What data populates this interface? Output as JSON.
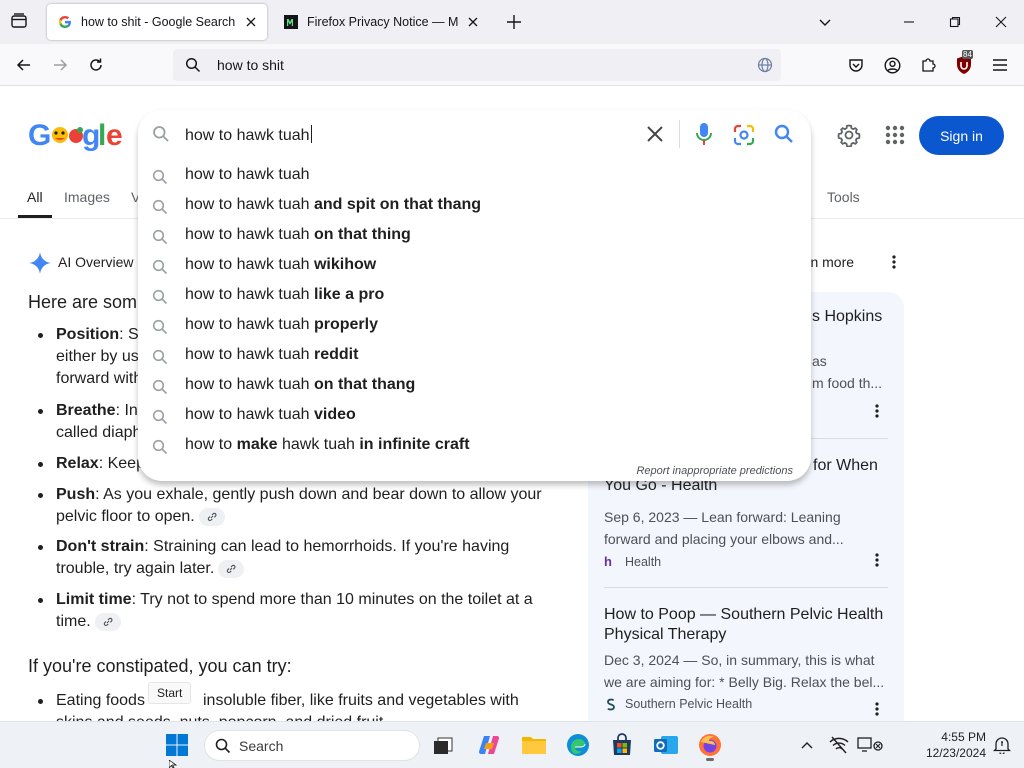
{
  "browser": {
    "tabs": [
      {
        "label": "how to shit - Google Search",
        "active": true,
        "icon": "google-g-icon"
      },
      {
        "label": "Firefox Privacy Notice — Mozill",
        "active": false,
        "icon": "mozilla-m-icon"
      }
    ],
    "url": "how to shit",
    "extension_badge": "84"
  },
  "google": {
    "search_value": "how to hawk tuah",
    "sign_in_label": "Sign in",
    "filters": [
      {
        "label": "All",
        "active": true
      },
      {
        "label": "Images",
        "active": false
      },
      {
        "label": "V",
        "active": false
      },
      {
        "label": "Tools",
        "active": false
      }
    ],
    "suggestions": [
      {
        "plain": "how to hawk tuah",
        "bold": ""
      },
      {
        "plain": "how to hawk tuah ",
        "bold": "and spit on that thang"
      },
      {
        "plain": "how to hawk tuah ",
        "bold": "on that thing"
      },
      {
        "plain": "how to hawk tuah ",
        "bold": "wikihow"
      },
      {
        "plain": "how to hawk tuah ",
        "bold": "like a pro"
      },
      {
        "plain": "how to hawk tuah ",
        "bold": "properly"
      },
      {
        "plain": "how to hawk tuah ",
        "bold": "reddit"
      },
      {
        "plain": "how to hawk tuah ",
        "bold": "on that thang"
      },
      {
        "plain": "how to hawk tuah ",
        "bold": "video"
      },
      {
        "segments": [
          [
            "how to ",
            false
          ],
          [
            "make",
            true
          ],
          [
            " hawk tuah ",
            false
          ],
          [
            "in infinite craft",
            true
          ]
        ]
      }
    ],
    "report_text": "Report inappropriate predictions",
    "ai_overview": {
      "label": "AI Overview",
      "learn_more": "arn more",
      "intro": "Here are som",
      "bullets": [
        {
          "term": "Position",
          "lines": [
            ": S",
            "either by us",
            "forward with"
          ]
        },
        {
          "term": "Breathe",
          "lines": [
            ": In",
            "called diaph"
          ]
        },
        {
          "term": "Relax",
          "lines": [
            ": Keep"
          ]
        },
        {
          "term": "Push",
          "lines": [
            ": As you exhale, gently push down and bear down to allow your",
            "pelvic floor to open."
          ]
        },
        {
          "term": "Don't strain",
          "lines": [
            ": Straining can lead to hemorrhoids. If you're having",
            "trouble, try again later."
          ]
        },
        {
          "term": "Limit time",
          "lines": [
            ": Try not to spend more than 10 minutes on the toilet at a",
            "time."
          ]
        }
      ],
      "constipated_heading": "If you're constipated, you can try:",
      "constipated_bullet_left": "Eating foods",
      "constipated_bullet_right": "insoluble fiber, like fruits and vegetables with",
      "constipated_bullet_line2": "skins and seeds, nuts, popcorn, and dried fruit"
    },
    "source_cards": [
      {
        "title": [
          "s Hopkins"
        ],
        "snippet": [
          "as",
          "m food th..."
        ],
        "source": ""
      },
      {
        "title": [
          "for When",
          "You Go - Health"
        ],
        "snippet": [
          "Sep 6, 2023 — Lean forward: Leaning",
          "forward and placing your elbows and..."
        ],
        "source": "Health"
      },
      {
        "title": [
          "How to Poop — Southern Pelvic Health",
          "Physical Therapy"
        ],
        "snippet": [
          "Dec 3, 2024 — So, in summary, this is what",
          "we are aiming for: * Belly Big. Relax the bel..."
        ],
        "source": "Southern Pelvic Health"
      }
    ]
  },
  "tooltip": "Start",
  "taskbar": {
    "search_placeholder": "Search",
    "time": "4:55 PM",
    "date": "12/23/2024"
  },
  "colors": {
    "accent": "#0b57d0",
    "google_blue": "#4285f4",
    "google_red": "#ea4335",
    "google_yellow": "#fbbc05",
    "google_green": "#34a853"
  }
}
